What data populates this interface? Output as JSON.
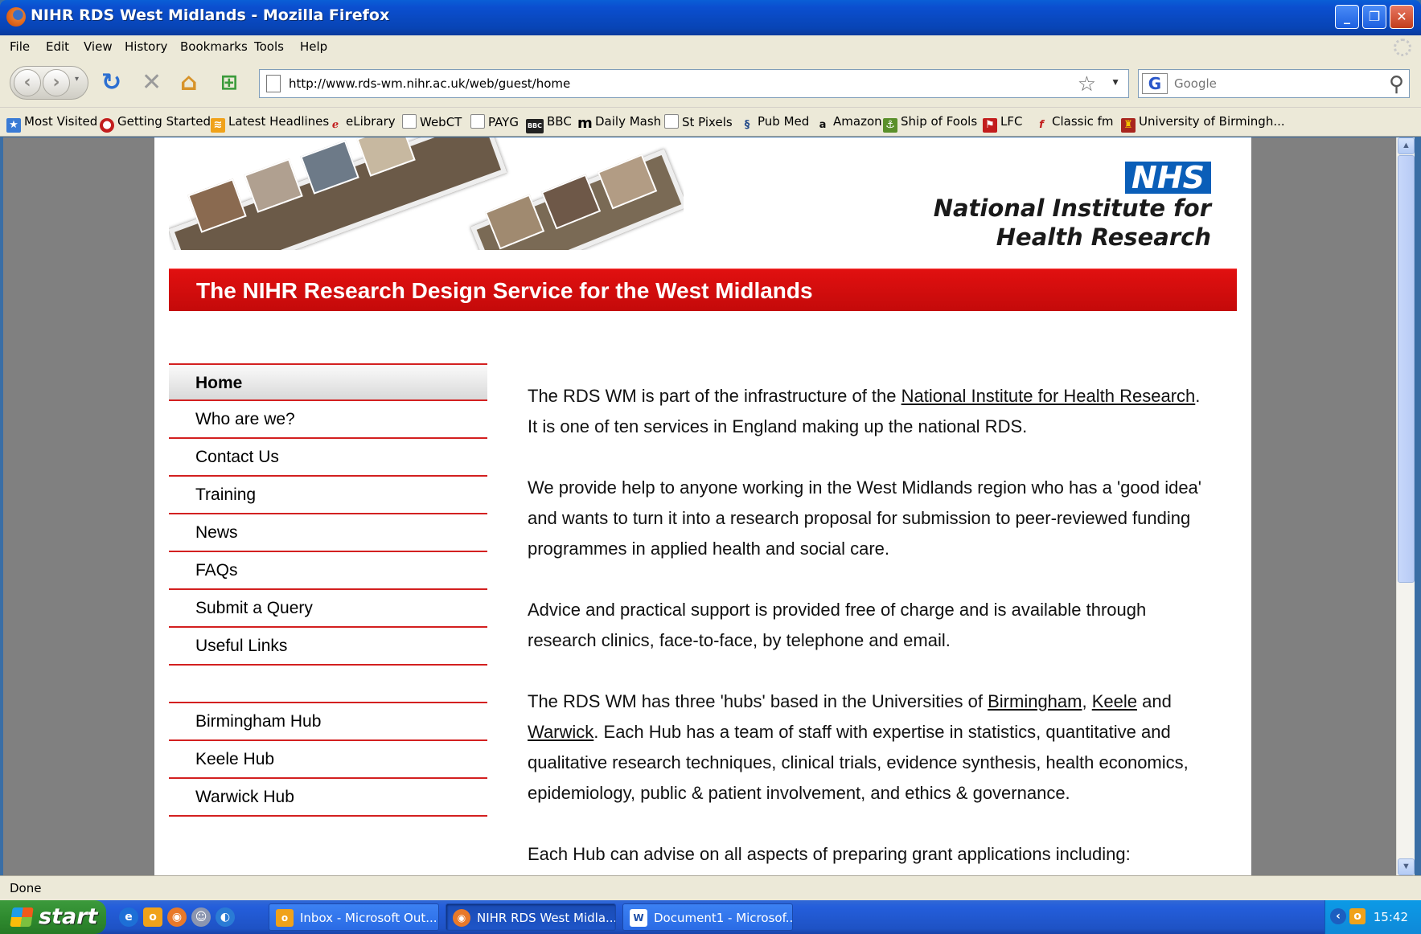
{
  "window": {
    "title": "NIHR RDS West Midlands - Mozilla Firefox"
  },
  "menu": [
    "File",
    "Edit",
    "View",
    "History",
    "Bookmarks",
    "Tools",
    "Help"
  ],
  "toolbar": {
    "url": "http://www.rds-wm.nihr.ac.uk/web/guest/home",
    "search_placeholder": "Google"
  },
  "bookmarks": [
    {
      "label": "Most Visited",
      "icon": "star-folder-icon"
    },
    {
      "label": "Getting Started",
      "icon": "firefox-icon"
    },
    {
      "label": "Latest Headlines",
      "icon": "rss-icon"
    },
    {
      "label": "eLibrary",
      "icon": "library-icon"
    },
    {
      "label": "WebCT",
      "icon": "page-icon"
    },
    {
      "label": "PAYG",
      "icon": "page-icon"
    },
    {
      "label": "BBC",
      "icon": "bbc-icon"
    },
    {
      "label": "Daily Mash",
      "icon": "m-icon"
    },
    {
      "label": "St Pixels",
      "icon": "page-icon"
    },
    {
      "label": "Pub Med",
      "icon": "pubmed-icon"
    },
    {
      "label": "Amazon",
      "icon": "amazon-icon"
    },
    {
      "label": "Ship of Fools",
      "icon": "ship-icon"
    },
    {
      "label": "LFC",
      "icon": "lfc-icon"
    },
    {
      "label": "Classic fm",
      "icon": "classicfm-icon"
    },
    {
      "label": "University of Birmingh...",
      "icon": "crest-icon"
    }
  ],
  "site": {
    "nhs_logo": "NHS",
    "nihr_line1": "National Institute for",
    "nihr_line2": "Health Research",
    "heading": "The NIHR Research Design Service for the West Midlands",
    "nav": [
      "Home",
      "Who are we?",
      "Contact Us",
      "Training",
      "News",
      "FAQs",
      "Submit a Query",
      "Useful Links"
    ],
    "hubs": [
      "Birmingham Hub",
      "Keele Hub",
      "Warwick Hub"
    ],
    "p1_a": "The RDS WM is part of the infrastructure of the ",
    "p1_link": "National Institute for Health Research",
    "p1_b": ". It is one of ten services in England making up the national RDS.",
    "p2": "We provide help to anyone working in the West Midlands region who has a 'good idea' and wants to turn it into a research proposal for submission to peer-reviewed funding programmes in applied health and social care.",
    "p3": "Advice and practical support is provided free of charge and is available through research clinics, face-to-face, by telephone and email.",
    "p4_a": "The RDS WM has three 'hubs' based in the Universities of ",
    "p4_link1": "Birmingham",
    "p4_sep": ", ",
    "p4_link2": "Keele",
    "p4_and": " and ",
    "p4_link3": "Warwick",
    "p4_b": ".  Each Hub has a team of staff with expertise in statistics, quantitative and qualitative research techniques, clinical trials, evidence synthesis, health economics, epidemiology, public & patient involvement, and ethics & governance.",
    "p5": "Each Hub can advise on all aspects of preparing grant applications including:"
  },
  "status": "Done",
  "taskbar": {
    "start": "start",
    "tasks": [
      "Inbox - Microsoft Out...",
      "NIHR RDS West Midla...",
      "Document1 - Microsof..."
    ],
    "clock": "15:42"
  },
  "colors": {
    "accent_red": "#d32020",
    "nhs_blue": "#0a5eb8"
  }
}
